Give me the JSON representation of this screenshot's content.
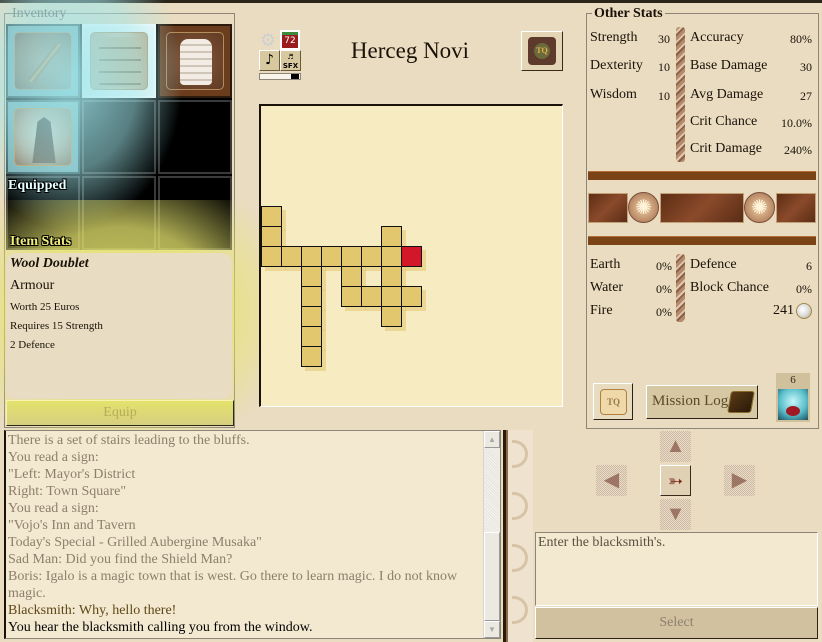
{
  "inventory": {
    "legend": "Inventory",
    "equipped_label": "Equipped",
    "slots": [
      {
        "item": "staff",
        "state": "equipped"
      },
      {
        "item": "leather-doublet",
        "state": "selected"
      },
      {
        "item": "white-vest",
        "state": "unequipped"
      },
      {
        "item": "cloak",
        "state": "equipped"
      },
      {
        "item": "",
        "state": "empty"
      },
      {
        "item": "",
        "state": "empty"
      },
      {
        "item": "",
        "state": "empty"
      },
      {
        "item": "",
        "state": "empty"
      },
      {
        "item": "",
        "state": "empty"
      }
    ]
  },
  "item_stats": {
    "label": "Item Stats",
    "name": "Wool Doublet",
    "type": "Armour",
    "lines": [
      "Worth 25 Euros",
      "Requires 15 Strength",
      "2 Defence"
    ],
    "equip_label": "Equip"
  },
  "toolbar": {
    "settings_icon": "gear-icon",
    "day_counter": "72",
    "music_icon": "music-note-icon",
    "sfx_label": "SFX",
    "volume_level": 1.0
  },
  "location": {
    "title": "Herceg Novi",
    "quest_icon_label": "TQ"
  },
  "map": {
    "cells": [
      [
        0,
        0
      ],
      [
        1,
        0
      ],
      [
        1,
        6
      ],
      [
        2,
        0
      ],
      [
        2,
        1
      ],
      [
        2,
        2
      ],
      [
        2,
        3
      ],
      [
        2,
        4
      ],
      [
        2,
        5
      ],
      [
        2,
        6
      ],
      [
        2,
        7
      ],
      [
        3,
        2
      ],
      [
        3,
        4
      ],
      [
        3,
        6
      ],
      [
        4,
        2
      ],
      [
        4,
        4
      ],
      [
        4,
        5
      ],
      [
        4,
        6
      ],
      [
        4,
        7
      ],
      [
        5,
        2
      ],
      [
        5,
        6
      ],
      [
        6,
        2
      ],
      [
        7,
        2
      ]
    ],
    "current": [
      2,
      7
    ],
    "colors": {
      "room": "#e2c76e",
      "current": "#d4162a",
      "background": "#f7ebc1"
    }
  },
  "other_stats": {
    "legend": "Other Stats",
    "attributes": [
      {
        "label": "Strength",
        "value": "30"
      },
      {
        "label": "Dexterity",
        "value": "10"
      },
      {
        "label": "Wisdom",
        "value": "10"
      }
    ],
    "combat": [
      {
        "label": "Accuracy",
        "value": "80%"
      },
      {
        "label": "Base Damage",
        "value": "30"
      },
      {
        "label": "Avg Damage",
        "value": "27"
      },
      {
        "label": "Crit Chance",
        "value": "10.0%"
      },
      {
        "label": "Crit Damage",
        "value": "240%"
      }
    ],
    "resistances": [
      {
        "label": "Earth",
        "value": "0%"
      },
      {
        "label": "Water",
        "value": "0%"
      },
      {
        "label": "Fire",
        "value": "0%"
      }
    ],
    "defence": [
      {
        "label": "Defence",
        "value": "6"
      },
      {
        "label": "Block Chance",
        "value": "0%"
      }
    ],
    "coins": "241",
    "tq_label": "TQ",
    "mission_log_label": "Mission Log",
    "potion_count": "6"
  },
  "log": {
    "lines": [
      {
        "text": "There is a set of stairs leading to the bluffs.",
        "kind": "old"
      },
      {
        "text": "You read a sign:",
        "kind": "old"
      },
      {
        "text": "\"Left: Mayor's District",
        "kind": "old"
      },
      {
        "text": "Right: Town Square\"",
        "kind": "old"
      },
      {
        "text": "You read a sign:",
        "kind": "old"
      },
      {
        "text": "\"Vojo's Inn and Tavern",
        "kind": "old"
      },
      {
        "text": "Today's Special - Grilled Aubergine Musaka\"",
        "kind": "old"
      },
      {
        "text": "Sad Man: Did you find the Shield Man?",
        "kind": "old"
      },
      {
        "text": "Boris: Igalo is a magic town that is west. Go there to learn magic. I do not know magic.",
        "kind": "old"
      },
      {
        "text": "Blacksmith: Why, hello there!",
        "kind": "npc"
      },
      {
        "text": "You hear the blacksmith calling you from the window.",
        "kind": "new"
      }
    ],
    "scroll_up": "▲",
    "scroll_down": "▼"
  },
  "navigation": {
    "up": "▲",
    "left": "◀",
    "right": "▶",
    "down": "▼",
    "center": "➳"
  },
  "action": {
    "text": "Enter the blacksmith's.",
    "select_label": "Select"
  }
}
